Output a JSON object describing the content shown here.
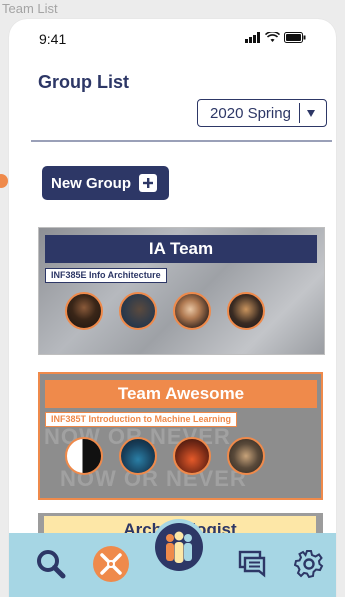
{
  "window_label": "Team List",
  "status_bar": {
    "time": "9:41"
  },
  "header": {
    "title": "Group List",
    "term_select": "2020 Spring"
  },
  "actions": {
    "new_group": "New Group"
  },
  "groups": [
    {
      "name": "IA Team",
      "course": "INF385E Info Architecture"
    },
    {
      "name": "Team Awesome",
      "course": "INF385T Introduction to Machine Learning"
    },
    {
      "name": "Archaeologist"
    }
  ],
  "card_watermark": "NOW OR NEVER",
  "colors": {
    "navy": "#2d3766",
    "orange": "#ef8a4b",
    "tabbar": "#a6d6e4",
    "yellow": "#fde7a7"
  },
  "tab_icons": [
    "search-icon",
    "no-meetings-icon",
    "people-icon",
    "messages-icon",
    "settings-icon"
  ]
}
